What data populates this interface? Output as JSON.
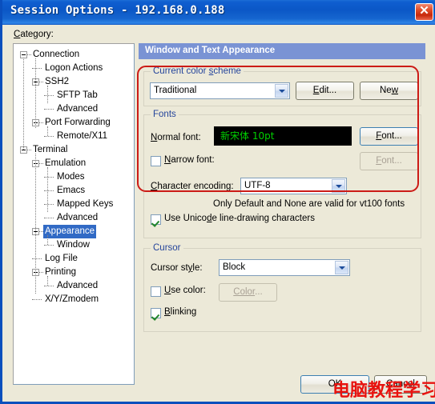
{
  "window": {
    "title": "Session Options - 192.168.0.188",
    "close_icon": "close-icon",
    "close_glyph": "✕"
  },
  "category": {
    "label_prefix": "C",
    "label_rest": "ategory:",
    "tree": [
      {
        "label": "Connection",
        "depth": 0,
        "expander": "minus",
        "selected": false
      },
      {
        "label": "Logon Actions",
        "depth": 1,
        "expander": "none",
        "selected": false
      },
      {
        "label": "SSH2",
        "depth": 1,
        "expander": "minus",
        "selected": false
      },
      {
        "label": "SFTP Tab",
        "depth": 2,
        "expander": "none",
        "selected": false
      },
      {
        "label": "Advanced",
        "depth": 2,
        "expander": "none",
        "selected": false
      },
      {
        "label": "Port Forwarding",
        "depth": 1,
        "expander": "minus",
        "selected": false
      },
      {
        "label": "Remote/X11",
        "depth": 2,
        "expander": "none",
        "selected": false
      },
      {
        "label": "Terminal",
        "depth": 0,
        "expander": "minus",
        "selected": false
      },
      {
        "label": "Emulation",
        "depth": 1,
        "expander": "minus",
        "selected": false
      },
      {
        "label": "Modes",
        "depth": 2,
        "expander": "none",
        "selected": false
      },
      {
        "label": "Emacs",
        "depth": 2,
        "expander": "none",
        "selected": false
      },
      {
        "label": "Mapped Keys",
        "depth": 2,
        "expander": "none",
        "selected": false
      },
      {
        "label": "Advanced",
        "depth": 2,
        "expander": "none",
        "selected": false
      },
      {
        "label": "Appearance",
        "depth": 1,
        "expander": "minus",
        "selected": true
      },
      {
        "label": "Window",
        "depth": 2,
        "expander": "none",
        "selected": false
      },
      {
        "label": "Log File",
        "depth": 1,
        "expander": "none",
        "selected": false
      },
      {
        "label": "Printing",
        "depth": 1,
        "expander": "minus",
        "selected": false
      },
      {
        "label": "Advanced",
        "depth": 2,
        "expander": "none",
        "selected": false
      },
      {
        "label": "X/Y/Zmodem",
        "depth": 1,
        "expander": "none",
        "selected": false
      }
    ]
  },
  "pane": {
    "header": "Window and Text Appearance",
    "color_scheme": {
      "group_title_a": "Current color ",
      "group_title_b": "s",
      "group_title_c": "cheme",
      "combo_value": "Traditional",
      "edit_button_a": "E",
      "edit_button_b": "dit...",
      "new_button_a": "Ne",
      "new_button_b": "w"
    },
    "fonts": {
      "group_title": "Fonts",
      "normal_font_label_a": "N",
      "normal_font_label_b": "ormal font:",
      "normal_font_sample": "新宋体  10pt",
      "normal_font_button_a": "F",
      "normal_font_button_b": "ont...",
      "narrow_font_label_a": "N",
      "narrow_font_label_b": "arrow font:",
      "narrow_font_checked": false,
      "narrow_font_button_a": "F",
      "narrow_font_button_b": "ont...",
      "narrow_font_button_enabled": false,
      "encoding_label_a": "C",
      "encoding_label_b": "haracter encoding:",
      "encoding_value": "UTF-8",
      "encoding_hint": "Only Default and None are valid for vt100 fonts",
      "unicode_label_a": "Use Unico",
      "unicode_label_b": "d",
      "unicode_label_c": "e line-drawing characters",
      "unicode_checked": true
    },
    "cursor": {
      "group_title": "Cursor",
      "style_label_a": "Cursor st",
      "style_label_b": "y",
      "style_label_c": "le:",
      "style_value": "Block",
      "use_color_label_a": "U",
      "use_color_label_b": "se color:",
      "use_color_checked": false,
      "color_button_a": "Color",
      "color_button_b": "...",
      "color_button_enabled": false,
      "blinking_label_a": "B",
      "blinking_label_b": "linking",
      "blinking_checked": true
    }
  },
  "footer": {
    "ok_label": "OK",
    "cancel_label": "Cancel"
  },
  "annotation": {
    "highlight_color": "#cc1b16",
    "watermark_text": "电脑教程学习网",
    "watermark_color": "#e8130f"
  }
}
